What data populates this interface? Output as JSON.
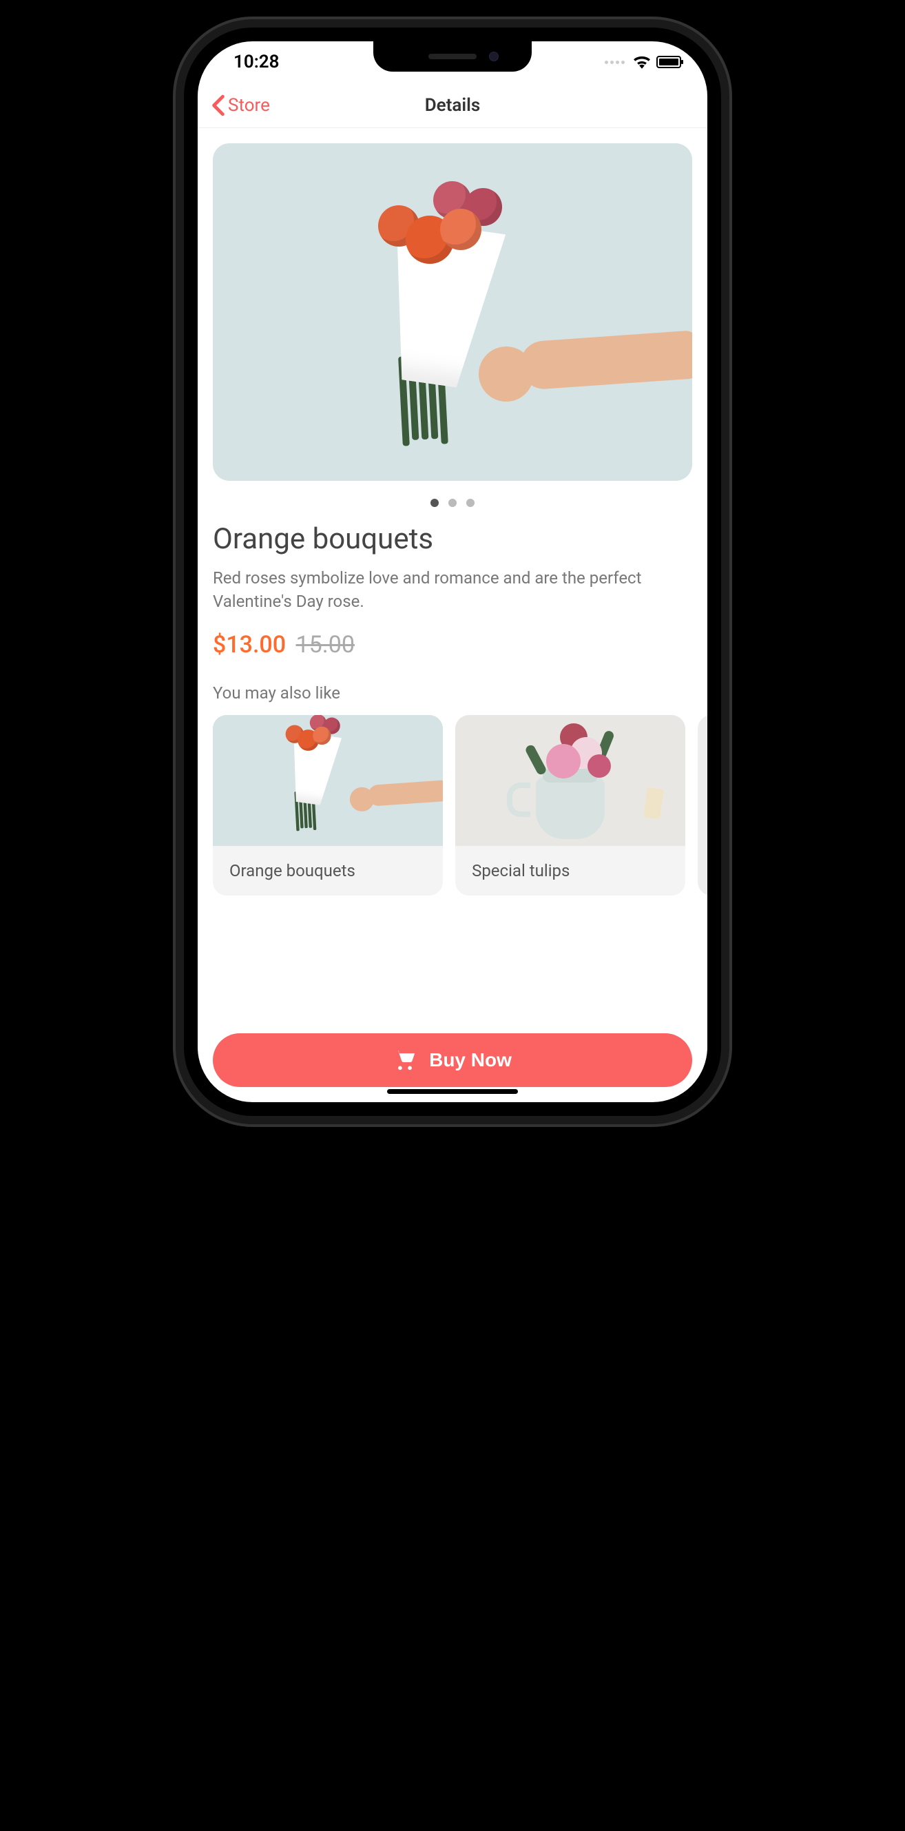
{
  "status": {
    "time": "10:28"
  },
  "nav": {
    "back_label": "Store",
    "title": "Details"
  },
  "product": {
    "title": "Orange bouquets",
    "description": "Red roses symbolize love and romance and are the perfect Valentine's Day rose.",
    "price": "$13.00",
    "old_price": "15.00",
    "image_count": 3,
    "active_image_index": 0
  },
  "recommend": {
    "section_title": "You may also like",
    "items": [
      {
        "title": "Orange bouquets"
      },
      {
        "title": "Special tulips"
      }
    ]
  },
  "actions": {
    "buy_label": "Buy Now"
  },
  "colors": {
    "accent": "#fb6363",
    "price": "#ff6b2d"
  }
}
